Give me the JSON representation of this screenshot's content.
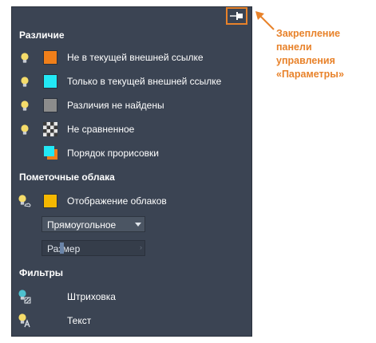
{
  "panel": {
    "section_difference": "Различие",
    "diff_items": [
      {
        "label": "Не в текущей внешней ссылке",
        "color": "#f07f1a",
        "icon": "lightbulb-icon"
      },
      {
        "label": "Только в текущей внешней ссылке",
        "color": "#22e8f5",
        "icon": "lightbulb-icon"
      },
      {
        "label": "Различия не найдены",
        "color": "#8c8c8c",
        "icon": "lightbulb-icon"
      },
      {
        "label": "Не сравненное",
        "color": "checkerboard",
        "icon": "lightbulb-icon"
      },
      {
        "label": "Порядок прорисовки",
        "color": "#f07f1a",
        "icon": "draw-order-icon"
      }
    ],
    "section_clouds": "Пометочные облака",
    "cloud_display_label": "Отображение облаков",
    "cloud_color": "#f5b800",
    "cloud_shape_select": "Прямоугольное",
    "size_placeholder": "Размер",
    "section_filters": "Фильтры",
    "filter_hatch": "Штриховка",
    "filter_text": "Текст"
  },
  "annotation": {
    "lines": [
      "Закрепление",
      "панели",
      "управления",
      "«Параметры»"
    ],
    "color": "#e8822a"
  }
}
